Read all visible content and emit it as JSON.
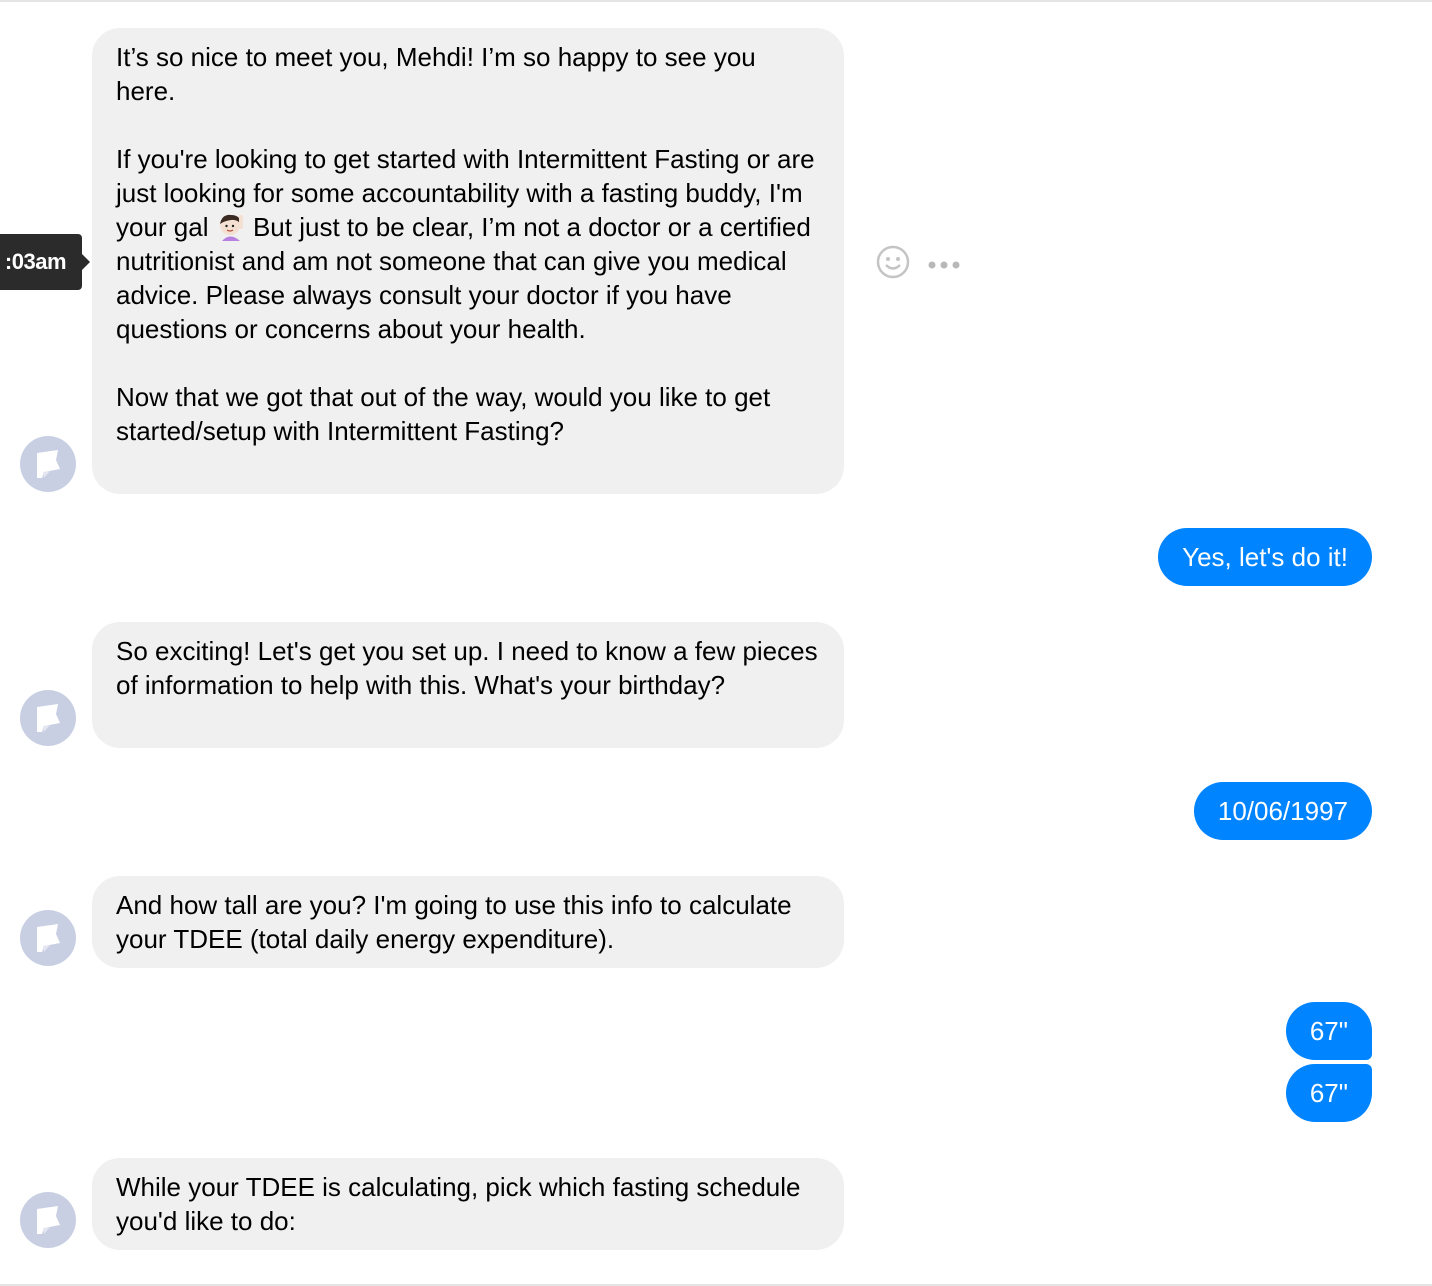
{
  "tooltip": {
    "time": ":03am"
  },
  "messages": {
    "m1_p1": "It’s so nice to meet you, Mehdi! I’m so happy to see you here.",
    "m1_p2a": "If you're looking to get started with Intermittent Fasting or are just looking for some accountability with a fasting buddy, I'm your gal ",
    "m1_p2b": " But just to be clear, I’m not a doctor or a certified nutritionist and am not someone that can give you medical advice. Please always consult your doctor if you have questions or concerns about your health.",
    "m1_p3": "Now that we got that out of the way, would you like to get started/setup with Intermittent Fasting?",
    "r1": "Yes, let's do it!",
    "m2": "So exciting! Let's get you set up. I need to know a few pieces of information to help with this. What's your birthday?",
    "r2": "10/06/1997",
    "m3": "And how tall are you? I'm going to use this info to calculate your TDEE (total daily energy expenditure).",
    "r3a": "67\"",
    "r3b": "67\"",
    "m4": "While your TDEE is calculating, pick which fasting schedule you'd like to do:"
  },
  "icons": {
    "react": "smiley-face-icon",
    "more": "more-options-icon",
    "avatar": "bot-avatar-flag-icon",
    "emoji": "woman-raising-hand-emoji"
  },
  "colors": {
    "incoming_bubble": "#f0f0f0",
    "outgoing_bubble": "#0084ff",
    "avatar_bg": "#c9cfe3",
    "tooltip_bg": "#2b2b2b"
  }
}
